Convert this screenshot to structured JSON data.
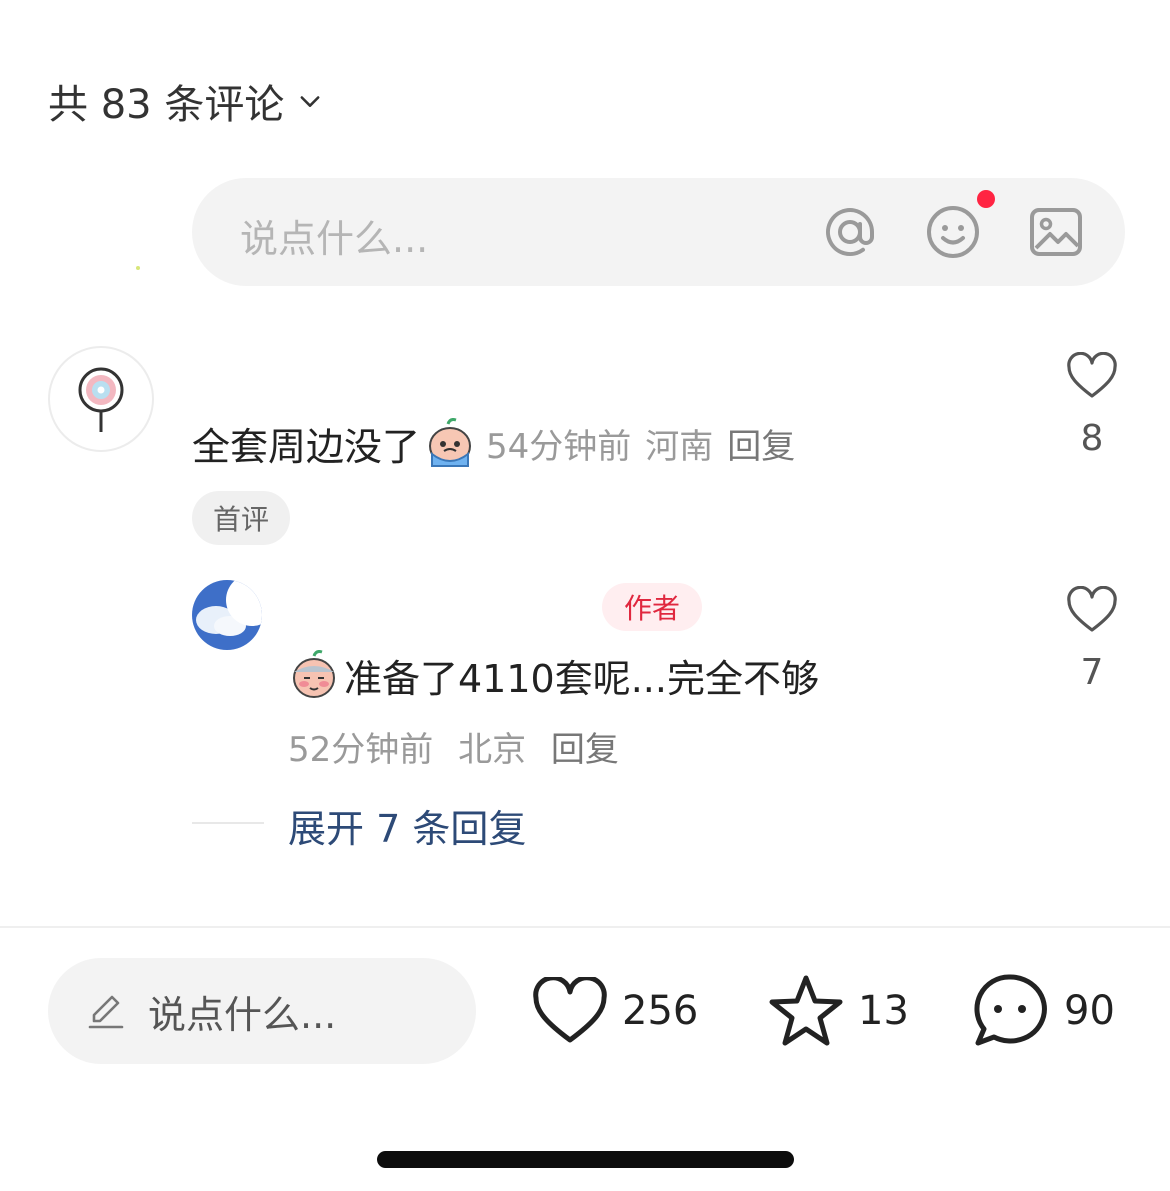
{
  "header": {
    "comment_count_label": "共 83 条评论",
    "chevron_icon": "chevron-down-icon"
  },
  "top_input": {
    "placeholder": "说点什么...",
    "icons": [
      "at-icon",
      "emoji-icon",
      "image-icon"
    ],
    "has_red_dot_on_emoji": true
  },
  "comments": [
    {
      "text": "全套周边没了",
      "emoji": "crying-emoji",
      "time": "54分钟前",
      "location": "河南",
      "reply_label": "回复",
      "tag": "首评",
      "likes": "8"
    },
    {
      "author_badge": "作者",
      "emoji": "blushing-emoji",
      "text": "准备了4110套呢...完全不够",
      "time": "52分钟前",
      "location": "北京",
      "reply_label": "回复",
      "likes": "7"
    }
  ],
  "expand_replies": "展开 7 条回复",
  "bottom_bar": {
    "placeholder": "说点什么...",
    "likes": "256",
    "favorites": "13",
    "comments": "90"
  },
  "colors": {
    "accent_red": "#ff2442",
    "link_blue": "#2d4a77",
    "input_bg": "#f3f3f3"
  }
}
